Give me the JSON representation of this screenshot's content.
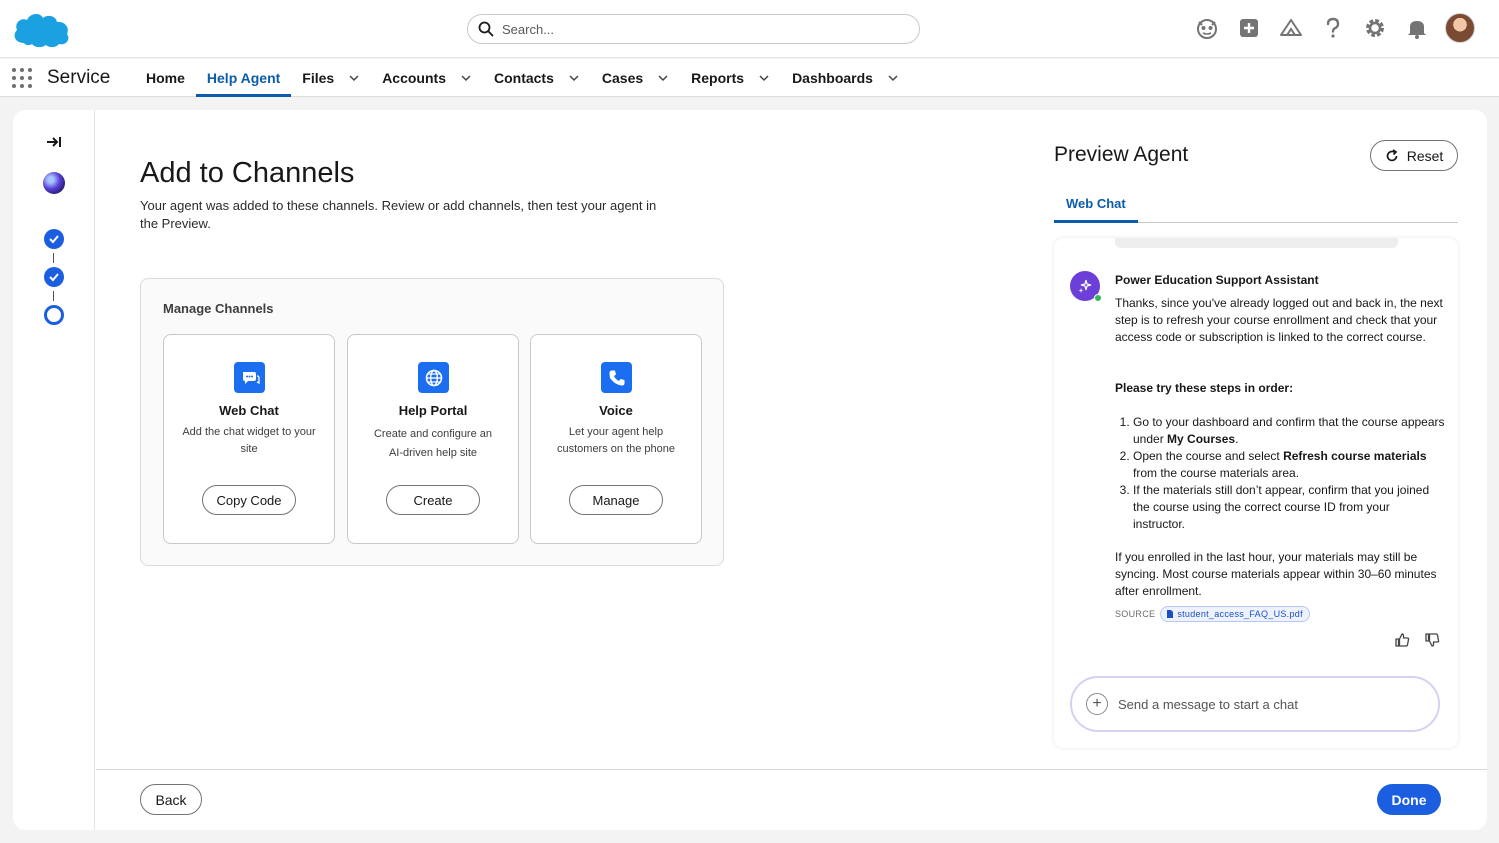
{
  "header": {
    "search_placeholder": "Search...",
    "icons": [
      "einstein-icon",
      "add-icon",
      "trailhead-icon",
      "help-icon",
      "setup-gear-icon",
      "notifications-bell-icon",
      "avatar"
    ]
  },
  "nav": {
    "app_name": "Service",
    "items": [
      {
        "label": "Home",
        "has_menu": false,
        "active": false
      },
      {
        "label": "Help Agent",
        "has_menu": false,
        "active": true
      },
      {
        "label": "Files",
        "has_menu": true,
        "active": false
      },
      {
        "label": "Accounts",
        "has_menu": true,
        "active": false
      },
      {
        "label": "Contacts",
        "has_menu": true,
        "active": false
      },
      {
        "label": "Cases",
        "has_menu": true,
        "active": false
      },
      {
        "label": "Reports",
        "has_menu": true,
        "active": false
      },
      {
        "label": "Dashboards",
        "has_menu": true,
        "active": false
      }
    ]
  },
  "page": {
    "title": "Add to Channels",
    "description": "Your agent was added to these channels. Review or add channels, then test your agent in the Preview."
  },
  "steps": [
    "done",
    "done",
    "current"
  ],
  "channels": {
    "title": "Manage Channels",
    "cards": [
      {
        "name": "Web Chat",
        "desc": "Add the chat widget to your site",
        "button": "Copy Code",
        "icon": "chat-icon"
      },
      {
        "name": "Help Portal",
        "desc": "Create and configure an AI-driven help site",
        "button": "Create",
        "icon": "globe-icon"
      },
      {
        "name": "Voice",
        "desc": "Let your agent help customers on the phone",
        "button": "Manage",
        "icon": "phone-icon"
      }
    ]
  },
  "preview": {
    "title": "Preview Agent",
    "reset_label": "Reset",
    "tab": "Web Chat",
    "bot_name": "Power Education Support Assistant",
    "intro": "Thanks, since you've already logged out and back in, the next step is to refresh your course enrollment and check that your access code or subscription is linked to the correct course.",
    "steps_heading": "Please try these steps in order:",
    "step1_a": "Go to your dashboard and confirm that the course appears under ",
    "step1_b": "My Courses",
    "step1_c": ".",
    "step2_a": "Open the course and select ",
    "step2_b": "Refresh course materials",
    "step2_c": " from the course materials area.",
    "step3": "If the materials still don’t appear, confirm that you joined the course using the correct course ID from your instructor.",
    "closing": "If you enrolled in the last hour, your materials may still be syncing. Most course materials appear within 30–60 minutes after enrollment.",
    "source_label": "SOURCE",
    "source_file": "student_access_FAQ_US.pdf",
    "input_placeholder": "Send a message to start a chat"
  },
  "footer": {
    "back_label": "Back",
    "done_label": "Done"
  },
  "colors": {
    "brand_blue": "#1b5fe0",
    "nav_active": "#0b5cab",
    "salesforce_cloud": "#1ba1e2",
    "bot_avatar": "#6c3fd8"
  }
}
